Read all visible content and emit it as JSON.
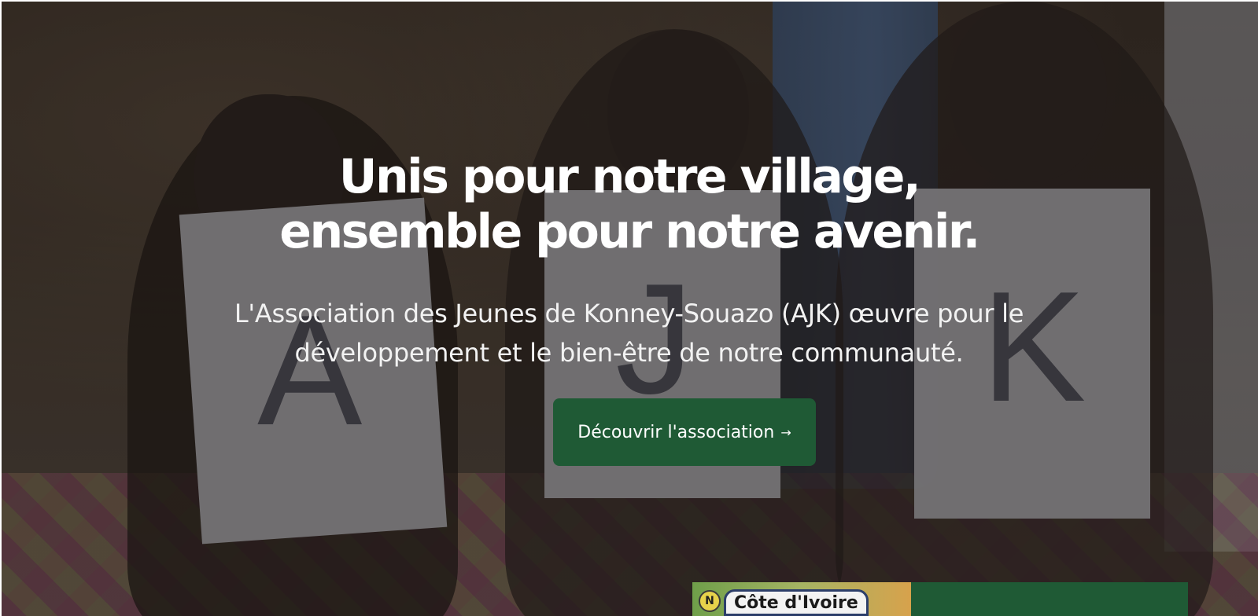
{
  "hero": {
    "title_line1": "Unis pour notre village,",
    "title_line2": "ensemble pour notre avenir.",
    "subtitle_line1": "L'Association des Jeunes de Konney-Souazo (AJK) œuvre pour le",
    "subtitle_line2": "développement et le bien-être de notre communauté.",
    "cta_label": "Découvrir l'association",
    "cta_arrow": "→",
    "image_letters": [
      "A",
      "J",
      "K"
    ]
  },
  "map_preview": {
    "compass_letter": "N",
    "label": "Côte d'Ivoire"
  },
  "colors": {
    "accent": "#1f5a35",
    "text_on_dark": "#ffffff"
  }
}
